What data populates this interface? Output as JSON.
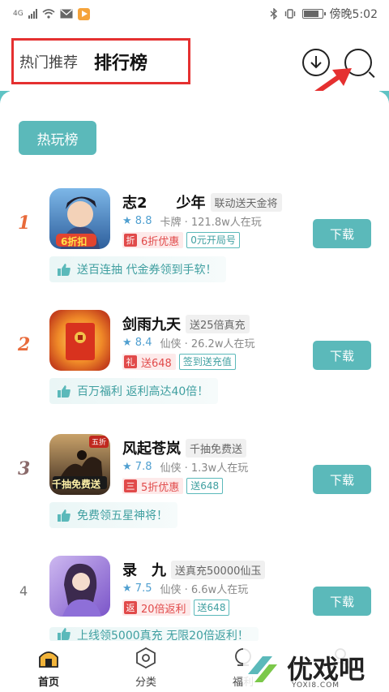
{
  "status_bar": {
    "network": "4G",
    "time_label": "傍晚5:02",
    "battery_level": 0.85
  },
  "header": {
    "tabs": [
      {
        "label": "热门推荐"
      },
      {
        "label": "排行榜"
      }
    ],
    "icons": [
      "download-icon",
      "search-icon"
    ]
  },
  "section_button": "热玩榜",
  "games": [
    {
      "rank": "1",
      "title": "志2　　少年",
      "tag": "联动送天金将",
      "rating": "8.8",
      "category_players": "卡牌 · 121.8w人在玩",
      "promo_icon": "折",
      "promo": "6折优惠",
      "outline_tag": "0元开局号",
      "download": "下载",
      "benefit": "送百连抽 代金券领到手软！",
      "icon_badge": "6折扣"
    },
    {
      "rank": "2",
      "title": "剑雨九天",
      "tag": "送25倍真充",
      "rating": "8.4",
      "category_players": "仙侠 · 26.2w人在玩",
      "promo_icon": "礼",
      "promo": "送648",
      "outline_tag": "签到送充值",
      "download": "下载",
      "benefit": "百万福利 返利高达40倍！"
    },
    {
      "rank": "3",
      "title": "风起苍岚",
      "tag": "千抽免费送",
      "rating": "7.8",
      "category_players": "仙侠 · 1.3w人在玩",
      "promo_icon": "三",
      "promo": "5折优惠",
      "outline_tag": "送648",
      "download": "下载",
      "benefit": "免费领五星神将！",
      "icon_badge": "千抽免费送",
      "icon_corner": "五折"
    },
    {
      "rank": "4",
      "title": "录　九",
      "tag": "送真充50000仙玉",
      "rating": "7.5",
      "category_players": "仙侠 · 6.6w人在玩",
      "promo_icon": "返",
      "promo": "20倍返利",
      "outline_tag": "送648",
      "download": "下载",
      "benefit": "上线领5000真充 无限20倍返利！"
    }
  ],
  "bottom_nav": [
    {
      "label": "首页"
    },
    {
      "label": "分类"
    },
    {
      "label": "福利"
    },
    {
      "label": ""
    }
  ],
  "watermark": {
    "text": "优戏吧",
    "url": "YOXI8.COM"
  },
  "colors": {
    "accent": "#5bb9ba",
    "highlight_box": "#e53030",
    "promo_red": "#e14a4a",
    "rank_orange": "#e86a3a"
  }
}
